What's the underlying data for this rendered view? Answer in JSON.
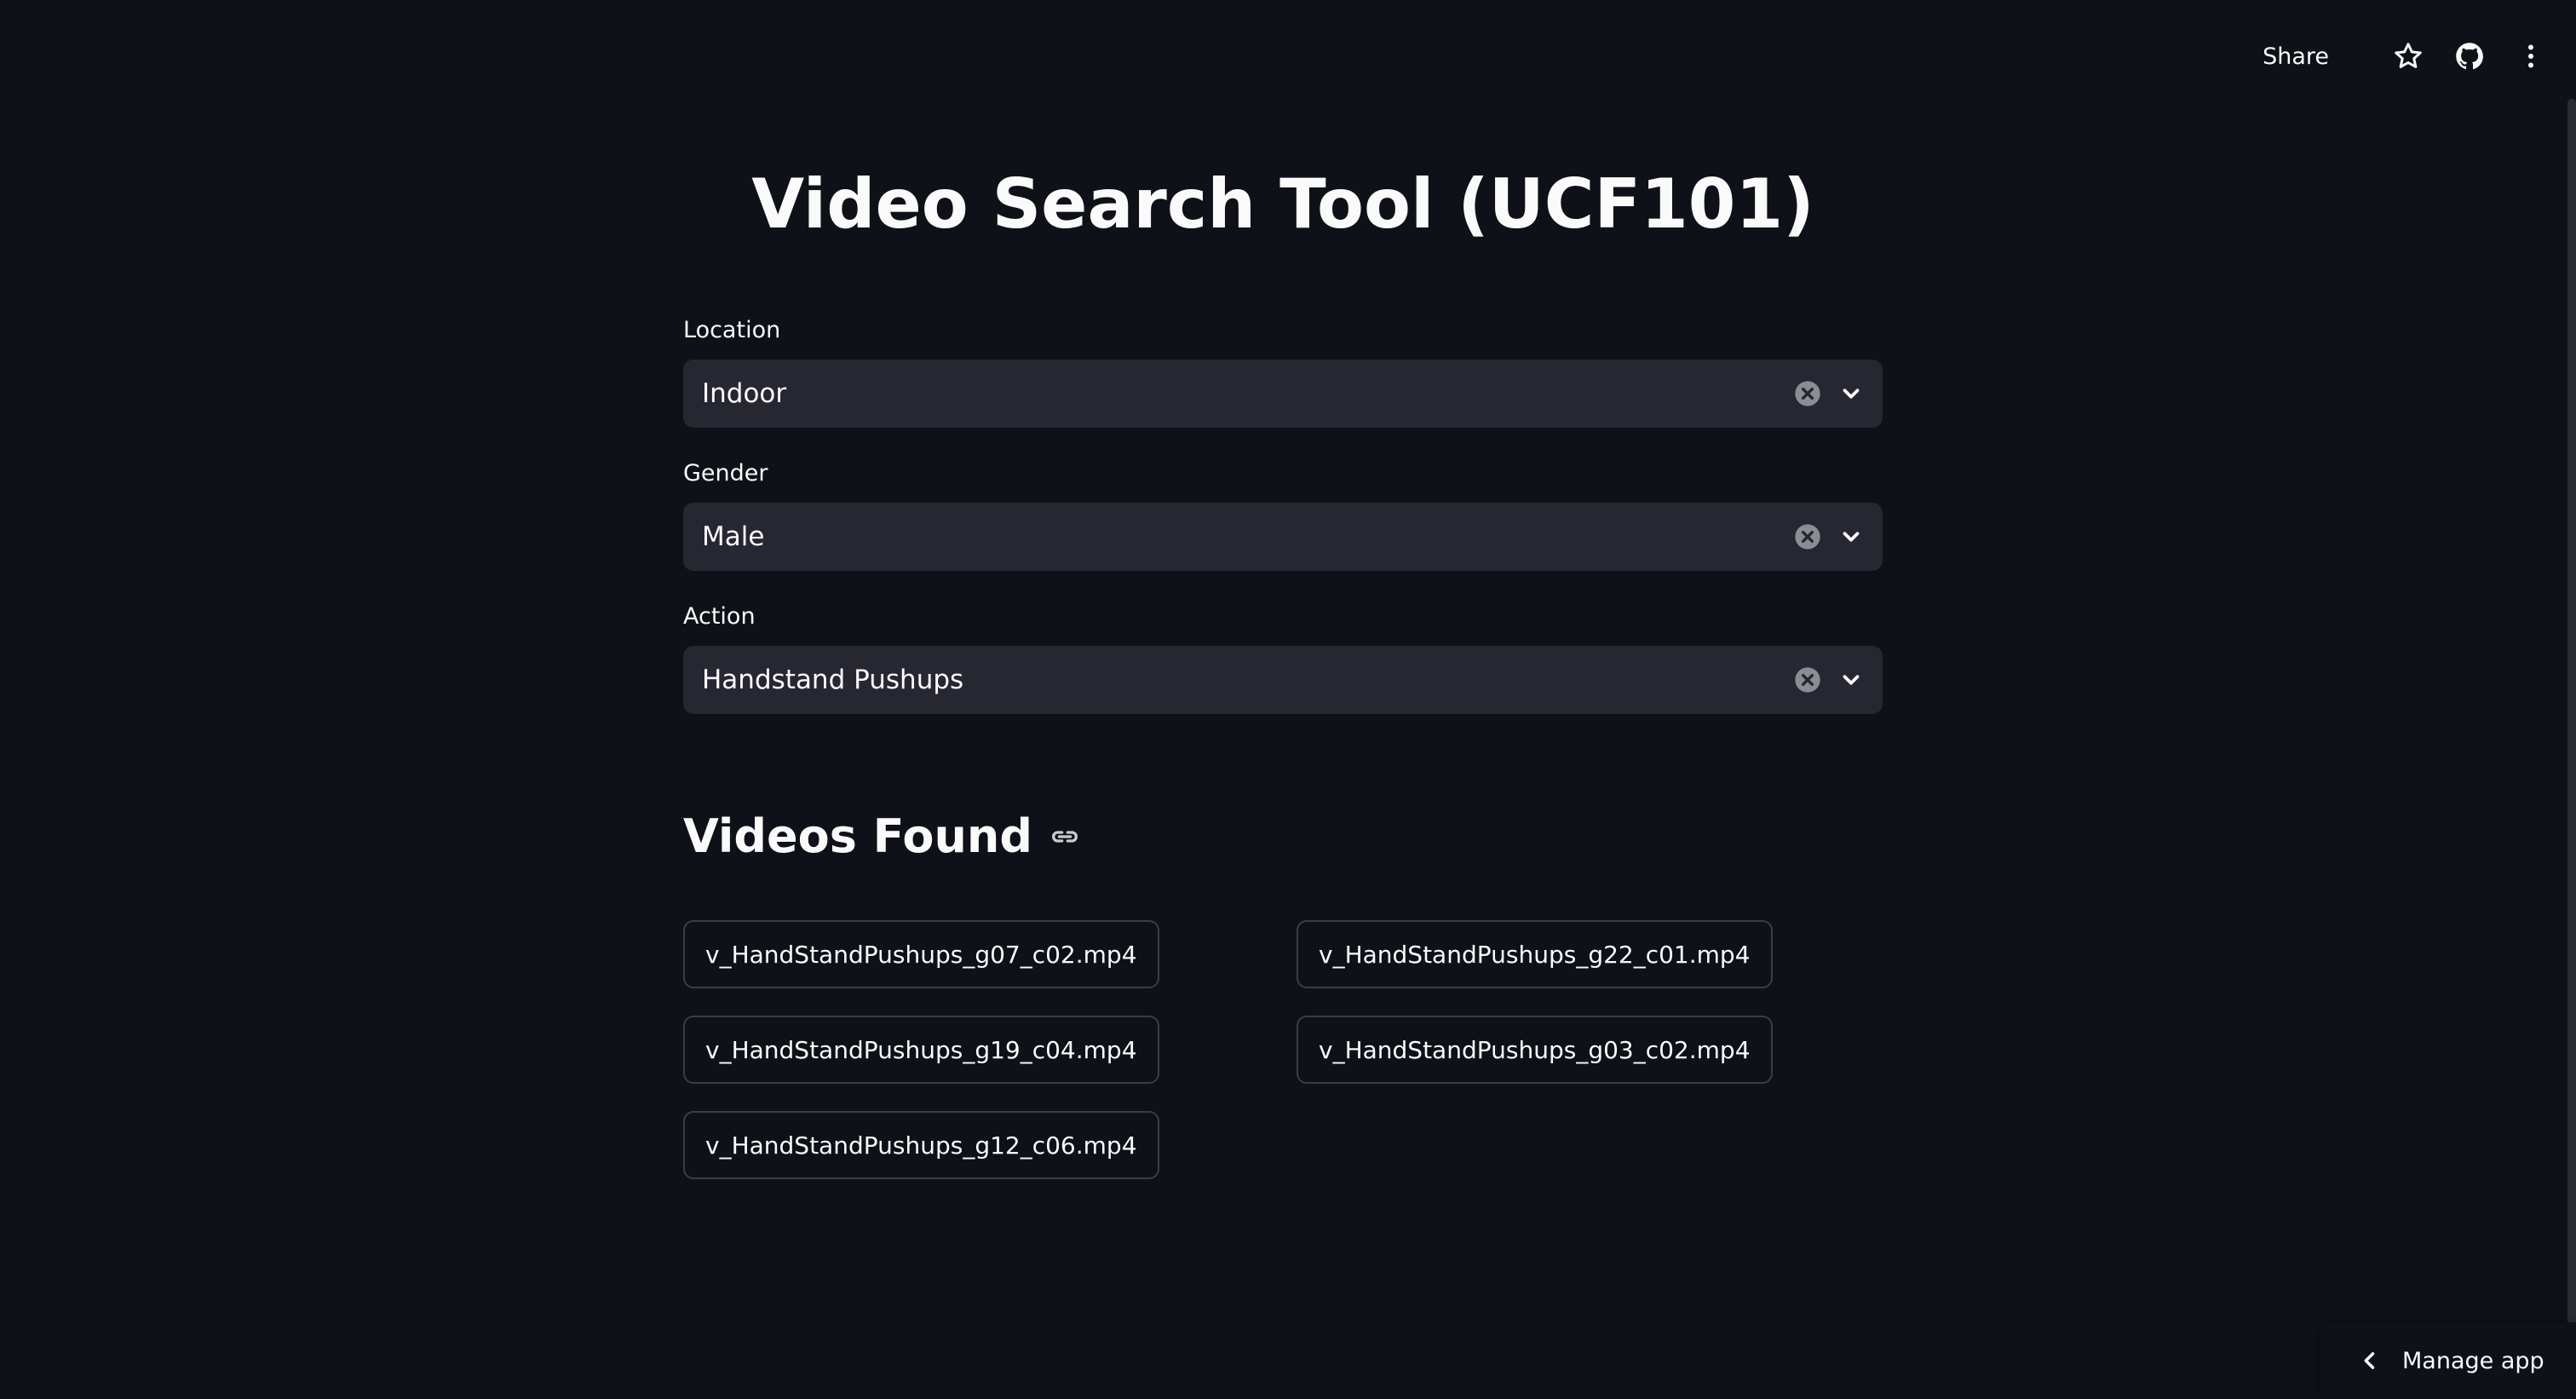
{
  "header": {
    "share_label": "Share",
    "icons": [
      "star-icon",
      "github-icon",
      "more-vertical-icon"
    ]
  },
  "page": {
    "title": "Video Search Tool (UCF101)"
  },
  "filters": {
    "location": {
      "label": "Location",
      "value": "Indoor"
    },
    "gender": {
      "label": "Gender",
      "value": "Male"
    },
    "action": {
      "label": "Action",
      "value": "Handstand Pushups"
    }
  },
  "results": {
    "heading": "Videos Found",
    "files": [
      "v_HandStandPushups_g07_c02.mp4",
      "v_HandStandPushups_g22_c01.mp4",
      "v_HandStandPushups_g19_c04.mp4",
      "v_HandStandPushups_g03_c02.mp4",
      "v_HandStandPushups_g12_c06.mp4"
    ]
  },
  "footer": {
    "manage_app_label": "Manage app"
  },
  "colors": {
    "background": "#0e1117",
    "input_background": "#262730",
    "text": "#fafafa",
    "border": "#3b3d45"
  }
}
